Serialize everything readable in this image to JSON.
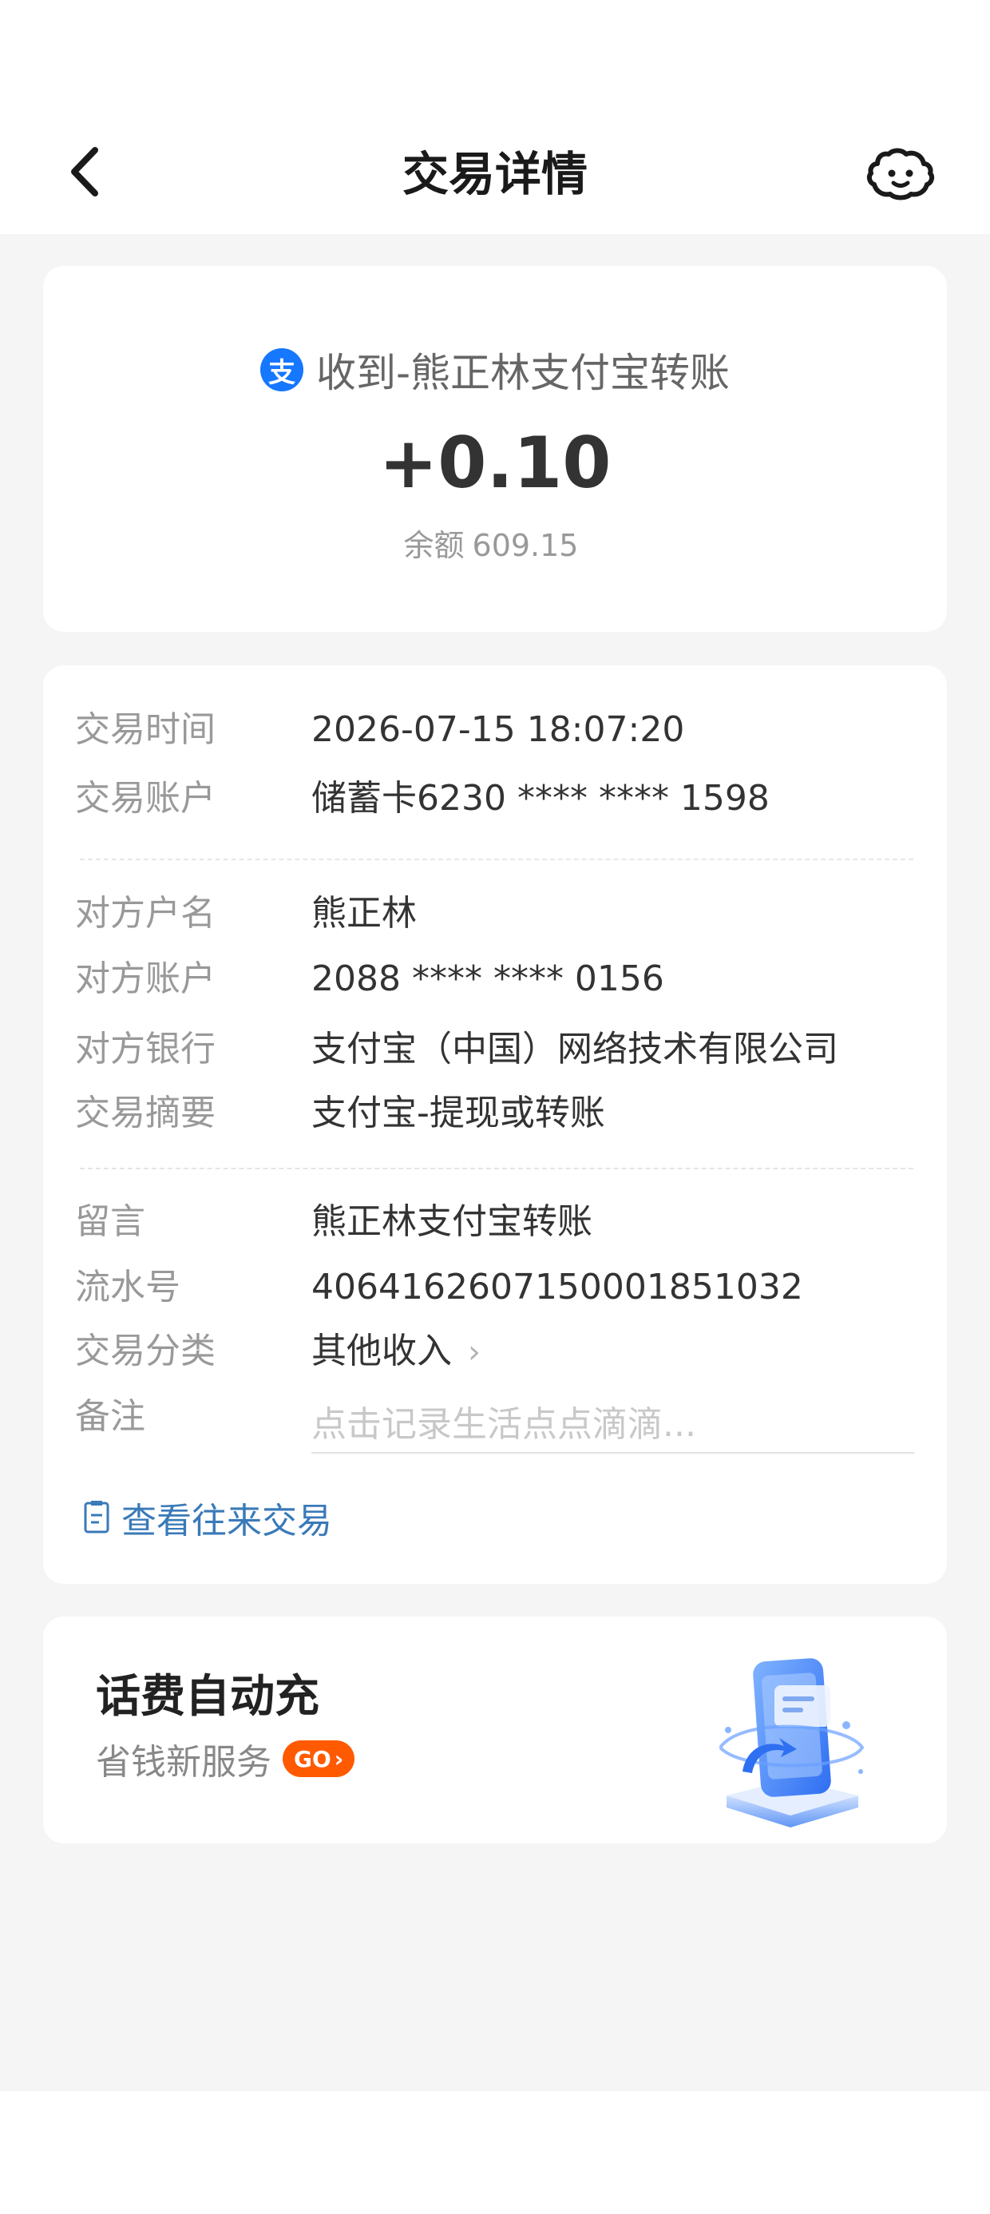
{
  "header": {
    "title": "交易详情",
    "back_icon": "chevron-left-icon",
    "service_icon": "customer-service-icon"
  },
  "summary": {
    "merchant_logo_text": "支",
    "merchant_name": "收到-熊正林支付宝转账",
    "amount": "+0.10",
    "balance_label": "余额",
    "balance_value": "609.15"
  },
  "details": {
    "time": {
      "label": "交易时间",
      "value": "2026-07-15 18:07:20"
    },
    "account": {
      "label": "交易账户",
      "value": "储蓄卡6230 **** **** 1598"
    },
    "payee_name": {
      "label": "对方户名",
      "value": "熊正林"
    },
    "payee_account": {
      "label": "对方账户",
      "value": "2088 **** **** 0156"
    },
    "payee_bank": {
      "label": "对方银行",
      "value": "支付宝（中国）网络技术有限公司"
    },
    "summary": {
      "label": "交易摘要",
      "value": "支付宝-提现或转账"
    },
    "message": {
      "label": "留言",
      "value": "熊正林支付宝转账"
    },
    "serial": {
      "label": "流水号",
      "value": "4064162607150001851032"
    },
    "category": {
      "label": "交易分类",
      "value": "其他收入"
    },
    "note": {
      "label": "备注",
      "value": "",
      "placeholder": "点击记录生活点点滴滴..."
    },
    "history_link": "查看往来交易"
  },
  "promo": {
    "title": "话费自动充",
    "subtitle": "省钱新服务",
    "go_label": "GO"
  },
  "colors": {
    "accent_blue": "#1677ff",
    "link_blue": "#3a7ab8",
    "go_orange": "#ff5a00",
    "background": "#f5f5f5"
  }
}
